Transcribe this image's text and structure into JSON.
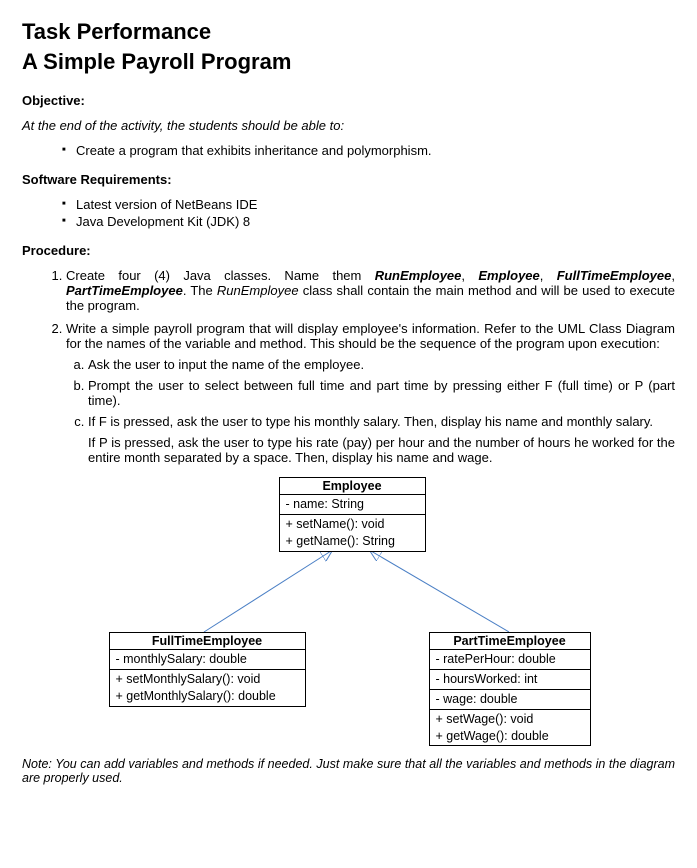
{
  "title_line1": "Task Performance",
  "title_line2": "A Simple Payroll Program",
  "objective_label": "Objective:",
  "objective_intro": "At the end of the activity, the students should be able to:",
  "objective_item": "Create a program that exhibits inheritance and polymorphism.",
  "software_label": "Software Requirements:",
  "software_items": {
    "0": "Latest version of NetBeans IDE",
    "1": "Java Development Kit (JDK) 8"
  },
  "procedure_label": "Procedure:",
  "proc1_a": "Create four (4) Java classes. Name them ",
  "proc1_run": "RunEmployee",
  "proc1_sep1": ", ",
  "proc1_emp": "Employee",
  "proc1_sep2": ", ",
  "proc1_full": "FullTimeEmployee",
  "proc1_sep3": ", ",
  "proc1_part": "PartTimeEmployee",
  "proc1_b": ". The ",
  "proc1_run2": "RunEmployee",
  "proc1_c": " class shall contain the main method and will be used to execute the program.",
  "proc2_intro": "Write a simple payroll program that will display employee's information. Refer to the UML Class Diagram for the names of the variable and method. This should be the sequence of the program upon execution:",
  "proc2_a": "Ask the user to input the name of the employee.",
  "proc2_b": "Prompt the user to select between full time and part time by pressing either F (full time) or P (part time).",
  "proc2_c1": "If F is pressed, ask the user to type his monthly salary. Then, display his name and monthly salary.",
  "proc2_c2": "If P is pressed, ask the user to type his rate (pay) per hour and the number of hours he worked for the entire month separated by a space. Then, display his name and wage.",
  "uml": {
    "employee": {
      "title": "Employee",
      "attr1": "-  name: String",
      "m1": "+  setName(): void",
      "m2": "+  getName(): String"
    },
    "full": {
      "title": "FullTimeEmployee",
      "attr1": "-  monthlySalary: double",
      "m1": "+  setMonthlySalary(): void",
      "m2": "+  getMonthlySalary(): double"
    },
    "part": {
      "title": "PartTimeEmployee",
      "a1": "-  ratePerHour: double",
      "a2": "-  hoursWorked: int",
      "a3": "-  wage: double",
      "m1": "+  setWage(): void",
      "m2": "+  getWage(): double"
    }
  },
  "note": "Note: You can add variables and methods if needed. Just make sure that all the variables and methods in the diagram are properly used."
}
